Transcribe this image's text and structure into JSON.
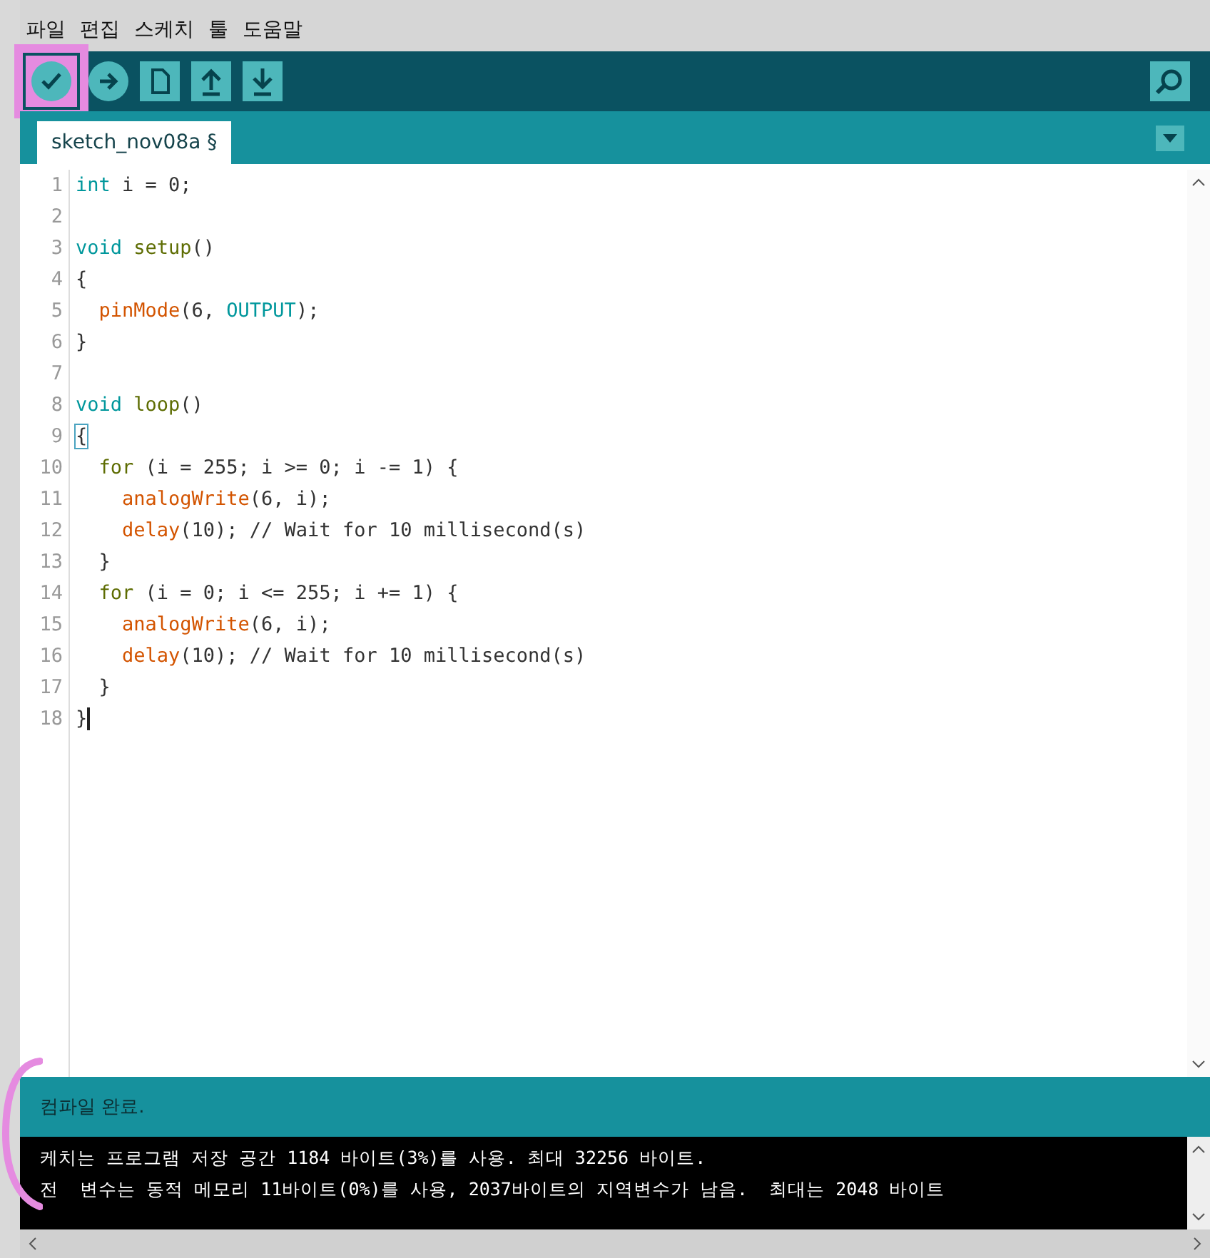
{
  "menu": [
    "파일",
    "편집",
    "스케치",
    "툴",
    "도움말"
  ],
  "toolbar": [
    {
      "kind": "verify",
      "highlighted": true
    },
    {
      "kind": "upload",
      "highlighted": false
    },
    {
      "kind": "new",
      "highlighted": false
    },
    {
      "kind": "open",
      "highlighted": false
    },
    {
      "kind": "save",
      "highlighted": false
    }
  ],
  "tabs": [
    {
      "label": "sketch_nov08a §",
      "selected": true
    }
  ],
  "editor": {
    "lines": [
      {
        "number": "1",
        "tokens": [
          {
            "text": "int",
            "kind": "type"
          },
          {
            "text": " i = 0;",
            "kind": "plain"
          }
        ]
      },
      {
        "number": "2"
      },
      {
        "number": "3",
        "tokens": [
          {
            "text": "void ",
            "kind": "type"
          },
          {
            "text": "setup",
            "kind": "func"
          },
          {
            "text": "()",
            "kind": "plain"
          }
        ]
      },
      {
        "number": "4",
        "tokens": [
          {
            "text": "{",
            "kind": "plain"
          }
        ]
      },
      {
        "number": "5",
        "tokens": [
          {
            "text": "  pinMode",
            "kind": "builtin"
          },
          {
            "text": "(6, ",
            "kind": "plain"
          },
          {
            "text": "OUTPUT",
            "kind": "type"
          },
          {
            "text": ");",
            "kind": "plain"
          }
        ]
      },
      {
        "number": "6",
        "tokens": [
          {
            "text": "}",
            "kind": "plain"
          }
        ]
      },
      {
        "number": "7"
      },
      {
        "number": "8",
        "tokens": [
          {
            "text": "void ",
            "kind": "type"
          },
          {
            "text": "loop",
            "kind": "func"
          },
          {
            "text": "()",
            "kind": "plain"
          }
        ]
      },
      {
        "number": "9",
        "tokens": [
          {
            "text": "{",
            "kind": "bracket"
          }
        ]
      },
      {
        "number": "10",
        "tokens": [
          {
            "text": "  for",
            "kind": "func"
          },
          {
            "text": " (i = 255; i >= 0; i -= 1) {",
            "kind": "plain"
          }
        ]
      },
      {
        "number": "11",
        "tokens": [
          {
            "text": "    analogWrite",
            "kind": "builtin"
          },
          {
            "text": "(6, i);",
            "kind": "plain"
          }
        ]
      },
      {
        "number": "12",
        "tokens": [
          {
            "text": "    delay",
            "kind": "builtin"
          },
          {
            "text": "(10); // Wait for 10 millisecond(s)",
            "kind": "plain"
          }
        ]
      },
      {
        "number": "13",
        "tokens": [
          {
            "text": "  }",
            "kind": "plain"
          }
        ]
      },
      {
        "number": "14",
        "tokens": [
          {
            "text": "  for",
            "kind": "func"
          },
          {
            "text": " (i = 0; i <= 255; i += 1) {",
            "kind": "plain"
          }
        ]
      },
      {
        "number": "15",
        "tokens": [
          {
            "text": "    analogWrite",
            "kind": "builtin"
          },
          {
            "text": "(6, i);",
            "kind": "plain"
          }
        ]
      },
      {
        "number": "16",
        "tokens": [
          {
            "text": "    delay",
            "kind": "builtin"
          },
          {
            "text": "(10); // Wait for 10 millisecond(s)",
            "kind": "plain"
          }
        ]
      },
      {
        "number": "17",
        "tokens": [
          {
            "text": "  }",
            "kind": "plain"
          }
        ]
      },
      {
        "number": "18",
        "tokens": [
          {
            "text": "}",
            "kind": "plain"
          }
        ],
        "cursor": true
      }
    ]
  },
  "status": "컴파일 완료.",
  "console": [
    "케치는 프로그램 저장 공간 1184 바이트(3%)를 사용. 최대 32256 바이트.",
    "전  변수는 동적 메모리 11바이트(0%)를 사용, 2037바이트의 지역변수가 남음.  최대는 2048 바이트"
  ]
}
